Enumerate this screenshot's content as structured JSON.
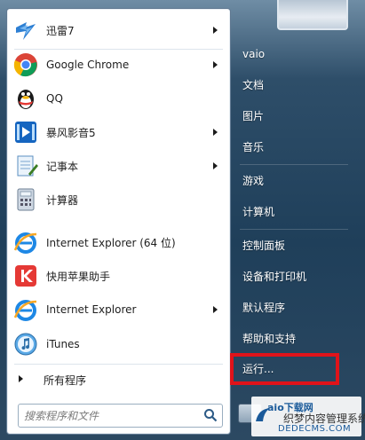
{
  "programs": [
    {
      "label": "迅雷7",
      "icon": "thunder-icon",
      "arrow": true
    },
    {
      "label": "Google Chrome",
      "icon": "chrome-icon",
      "arrow": true
    },
    {
      "label": "QQ",
      "icon": "qq-penguin-icon",
      "arrow": false
    },
    {
      "label": "暴风影音5",
      "icon": "baofeng-icon",
      "arrow": true
    },
    {
      "label": "记事本",
      "icon": "notepad-icon",
      "arrow": true
    },
    {
      "label": "计算器",
      "icon": "calculator-icon",
      "arrow": false
    },
    {
      "label": "Internet Explorer (64 位)",
      "icon": "internet-explorer-icon",
      "arrow": false
    },
    {
      "label": "快用苹果助手",
      "icon": "kuaiyong-icon",
      "arrow": false
    },
    {
      "label": "Internet Explorer",
      "icon": "internet-explorer-icon",
      "arrow": true
    },
    {
      "label": "iTunes",
      "icon": "itunes-icon",
      "arrow": false
    }
  ],
  "all_programs": "所有程序",
  "search": {
    "placeholder": "搜索程序和文件"
  },
  "right_items": [
    "vaio",
    "文档",
    "图片",
    "音乐",
    "游戏",
    "计算机",
    "控制面板",
    "设备和打印机",
    "默认程序",
    "帮助和支持",
    "运行..."
  ],
  "watermark": {
    "brand": "织梦内容管理系统",
    "domain": "DEDECMS.COM",
    "partial": "aio下载网"
  },
  "colors": {
    "highlight": "#e0131a",
    "panel_dark": "#1f3f5a"
  }
}
